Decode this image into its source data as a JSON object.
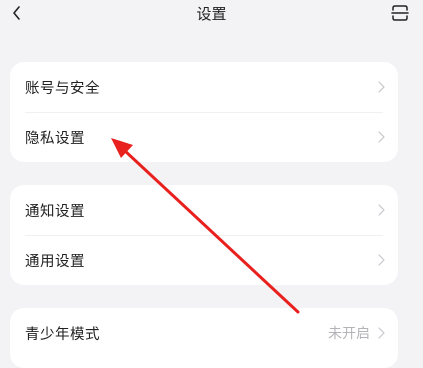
{
  "header": {
    "title": "设置"
  },
  "groups": [
    {
      "items": [
        {
          "label": "账号与安全"
        },
        {
          "label": "隐私设置"
        }
      ]
    },
    {
      "items": [
        {
          "label": "通知设置"
        },
        {
          "label": "通用设置"
        }
      ]
    },
    {
      "items": [
        {
          "label": "青少年模式",
          "value": "未开启"
        }
      ]
    }
  ],
  "colors": {
    "background": "#f3f3f5",
    "card": "#ffffff",
    "annotation_arrow": "#e8201e"
  },
  "icons": {
    "back": "chevron-left-icon",
    "scan": "scan-icon",
    "row_chevron": "chevron-right-icon"
  }
}
